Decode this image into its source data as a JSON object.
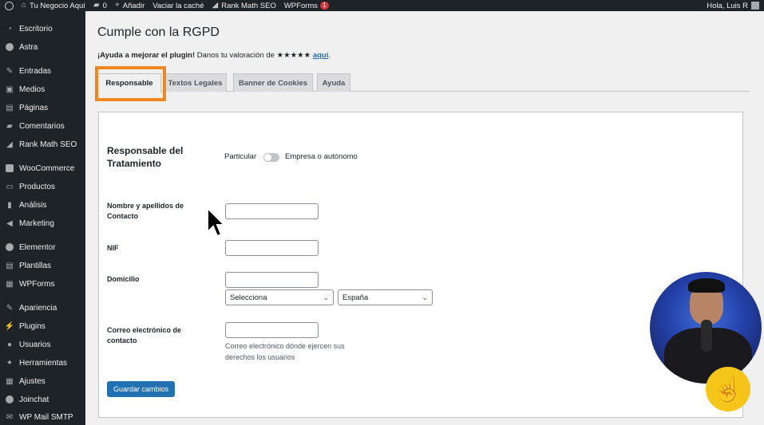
{
  "adminbar": {
    "site_name": "Tu Negocio Aquí",
    "comments_count": "0",
    "add_new": "Añadir",
    "clear_cache": "Vaciar la caché",
    "rank_math": "Rank Math SEO",
    "wpforms": "WPForms",
    "wpforms_badge": "1",
    "greeting": "Hola, Luis R"
  },
  "sidebar": {
    "items": [
      {
        "label": "Escritorio",
        "icon": "dashboard-icon"
      },
      {
        "label": "Astra",
        "icon": "astra-icon"
      },
      {
        "label": "Entradas",
        "icon": "pin-icon"
      },
      {
        "label": "Medios",
        "icon": "media-icon"
      },
      {
        "label": "Páginas",
        "icon": "pages-icon"
      },
      {
        "label": "Comentarios",
        "icon": "comments-icon"
      },
      {
        "label": "Rank Math SEO",
        "icon": "rankmath-icon"
      },
      {
        "label": "WooCommerce",
        "icon": "woocommerce-icon"
      },
      {
        "label": "Productos",
        "icon": "products-icon"
      },
      {
        "label": "Análisis",
        "icon": "analytics-icon"
      },
      {
        "label": "Marketing",
        "icon": "megaphone-icon"
      },
      {
        "label": "Elementor",
        "icon": "elementor-icon"
      },
      {
        "label": "Plantillas",
        "icon": "templates-icon"
      },
      {
        "label": "WPForms",
        "icon": "wpforms-icon"
      },
      {
        "label": "Apariencia",
        "icon": "brush-icon"
      },
      {
        "label": "Plugins",
        "icon": "plugin-icon"
      },
      {
        "label": "Usuarios",
        "icon": "users-icon"
      },
      {
        "label": "Herramientas",
        "icon": "wrench-icon"
      },
      {
        "label": "Ajustes",
        "icon": "settings-icon"
      },
      {
        "label": "Joinchat",
        "icon": "whatsapp-icon"
      },
      {
        "label": "WP Mail SMTP",
        "icon": "mail-icon"
      }
    ]
  },
  "page": {
    "title": "Cumple con la RGPD",
    "promo_bold": "¡Ayuda a mejorar el plugin!",
    "promo_text": " Danos tu valoración de ",
    "promo_stars": "★★★★★",
    "promo_link": "aquí",
    "promo_end": "."
  },
  "tabs": [
    {
      "label": "Responsable",
      "active": true
    },
    {
      "label": "Textos Legales",
      "active": false
    },
    {
      "label": "Banner de Cookies",
      "active": false
    },
    {
      "label": "Ayuda",
      "active": false
    }
  ],
  "form": {
    "section_title": "Responsable del Tratamiento",
    "toggle_left": "Particular",
    "toggle_right": "Empresa o autónomo",
    "name_label": "Nombre y apellidos de Contacto",
    "name_value": "",
    "nif_label": "NIF",
    "nif_value": "",
    "address_label": "Domicilio",
    "address_value": "",
    "province_select": "Selecciona",
    "country_select": "España",
    "email_label": "Correo electrónico de contacto",
    "email_value": "",
    "email_help": "Correo electrónico dónde ejercen sus derechos los usuarios",
    "save_button": "Guardar cambios"
  },
  "colors": {
    "admin_bg": "#1d2327",
    "accent": "#2271b1",
    "highlight": "#f0861e",
    "badge": "#d63638"
  }
}
